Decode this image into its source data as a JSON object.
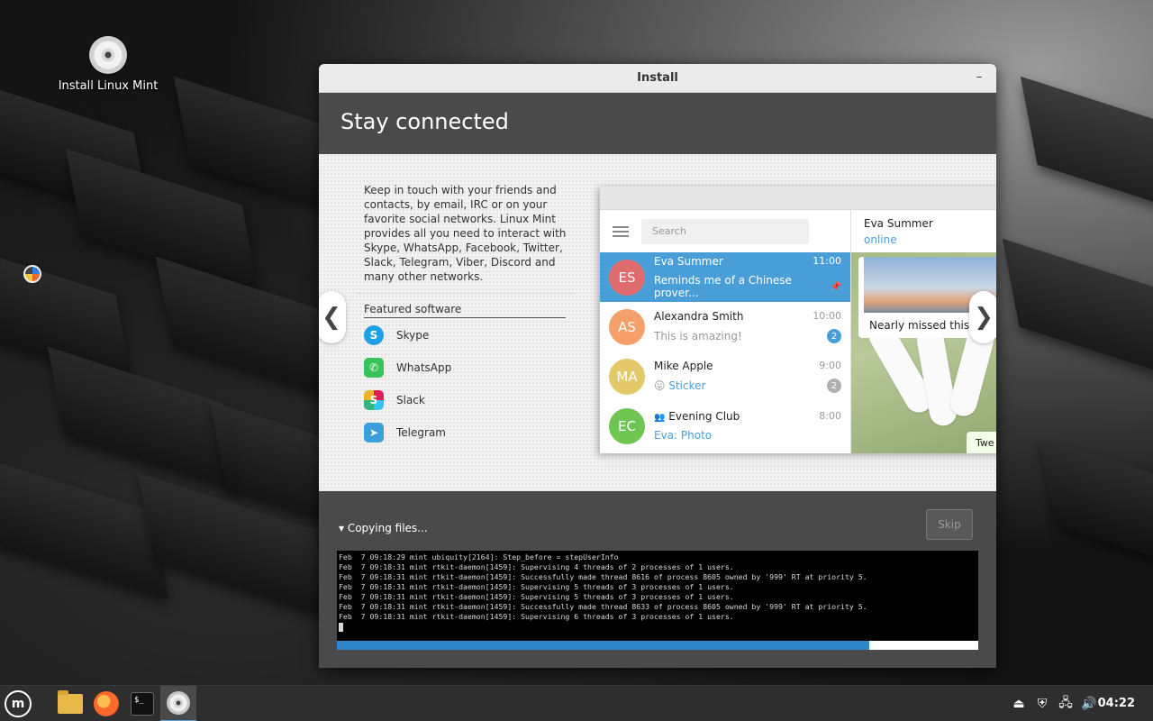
{
  "desktop": {
    "icon_label": "Install Linux Mint"
  },
  "window": {
    "title": "Install",
    "minimize_glyph": "–",
    "header_title": "Stay connected"
  },
  "slide": {
    "description": "Keep in touch with your friends and contacts, by email, IRC or on your favorite social networks. Linux Mint provides all you need to interact with Skype, WhatsApp, Facebook, Twitter, Slack, Telegram, Viber, Discord and many other networks.",
    "featured_title": "Featured software",
    "apps": [
      {
        "name": "Skype",
        "icon": "skype-icon",
        "color": "#1ea1e4",
        "glyph": "S"
      },
      {
        "name": "WhatsApp",
        "icon": "whatsapp-icon",
        "color": "#38c35a",
        "glyph": "✆"
      },
      {
        "name": "Slack",
        "icon": "slack-icon",
        "color": "#e4a02a",
        "glyph": "S"
      },
      {
        "name": "Telegram",
        "icon": "telegram-icon",
        "color": "#3b9fd8",
        "glyph": "➤"
      }
    ],
    "prev_glyph": "❮",
    "next_glyph": "❯"
  },
  "telegram": {
    "search_placeholder": "Search",
    "chats": [
      {
        "initials": "ES",
        "name": "Eva Summer",
        "time": "11:00",
        "preview": "Reminds me of a Chinese prover...",
        "avatar_color": "#e06b6f",
        "active": true,
        "pin": "📌"
      },
      {
        "initials": "AS",
        "name": "Alexandra Smith",
        "time": "10:00",
        "preview": "This is amazing!",
        "avatar_color": "#f5a06a",
        "badge": "2",
        "badge_color": "#4a9ed8"
      },
      {
        "initials": "MA",
        "name": "Mike Apple",
        "time": "9:00",
        "preview_emoji": "😛",
        "preview": "Sticker",
        "avatar_color": "#e3c96a",
        "badge": "2",
        "badge_color": "#b0b0b0"
      },
      {
        "initials": "EC",
        "name": "Evening Club",
        "time": "8:00",
        "preview": "Eva: Photo",
        "avatar_color": "#6fc552",
        "group_glyph": "👥"
      }
    ],
    "conversation": {
      "name": "Eva Summer",
      "status": "online",
      "caption": "Nearly missed this s",
      "tw_text": "Twe"
    }
  },
  "bottom": {
    "status": "▾ Copying files...",
    "skip_label": "Skip",
    "progress": 0.83,
    "log_lines": [
      "Feb  7 09:18:29 mint ubiquity[2164]: Step_before = stepUserInfo",
      "Feb  7 09:18:31 mint rtkit-daemon[1459]: Supervising 4 threads of 2 processes of 1 users.",
      "Feb  7 09:18:31 mint rtkit-daemon[1459]: Successfully made thread 8616 of process 8605 owned by '999' RT at priority 5.",
      "Feb  7 09:18:31 mint rtkit-daemon[1459]: Supervising 5 threads of 3 processes of 1 users.",
      "Feb  7 09:18:31 mint rtkit-daemon[1459]: Supervising 5 threads of 3 processes of 1 users.",
      "Feb  7 09:18:31 mint rtkit-daemon[1459]: Successfully made thread 8633 of process 8605 owned by '999' RT at priority 5.",
      "Feb  7 09:18:31 mint rtkit-daemon[1459]: Supervising 6 threads of 3 processes of 1 users."
    ]
  },
  "taskbar": {
    "mint_glyph": "m",
    "terminal_glyph": "$_",
    "clock": "04:22",
    "tray": [
      "⏏",
      "⛨",
      "🖧",
      "🔊"
    ]
  }
}
